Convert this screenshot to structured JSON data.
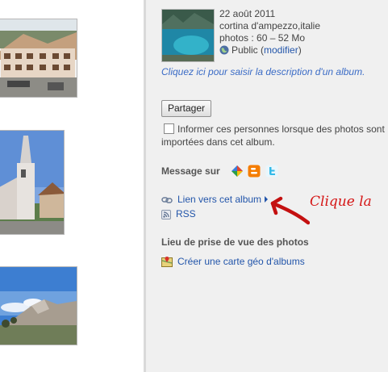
{
  "album": {
    "date": "22 août 2011",
    "location": "cortina d'ampezzo,italie",
    "photos_info": "photos : 60 – 52 Mo",
    "visibility": "Public (",
    "modify_link": "modifier",
    "visibility_close": ")",
    "description_prompt": "Cliquez ici pour saisir la description d'un album."
  },
  "share": {
    "button_label": "Partager",
    "notify_label": "Informer ces personnes lorsque des photos sont importées dans cet album."
  },
  "message": {
    "title": "Message sur",
    "services": [
      "buzz-icon",
      "blogger-icon",
      "twitter-icon"
    ]
  },
  "links": {
    "album_link": "Lien vers cet album",
    "rss": "RSS"
  },
  "geo": {
    "title": "Lieu de prise de vue des photos",
    "map_link": "Créer une carte géo d'albums"
  },
  "annotation": {
    "text": "Clique la",
    "color": "#d51515"
  },
  "colors": {
    "link": "#2255aa",
    "description": "#3b6cc6",
    "sidebar_bg": "#f0f0f0"
  }
}
